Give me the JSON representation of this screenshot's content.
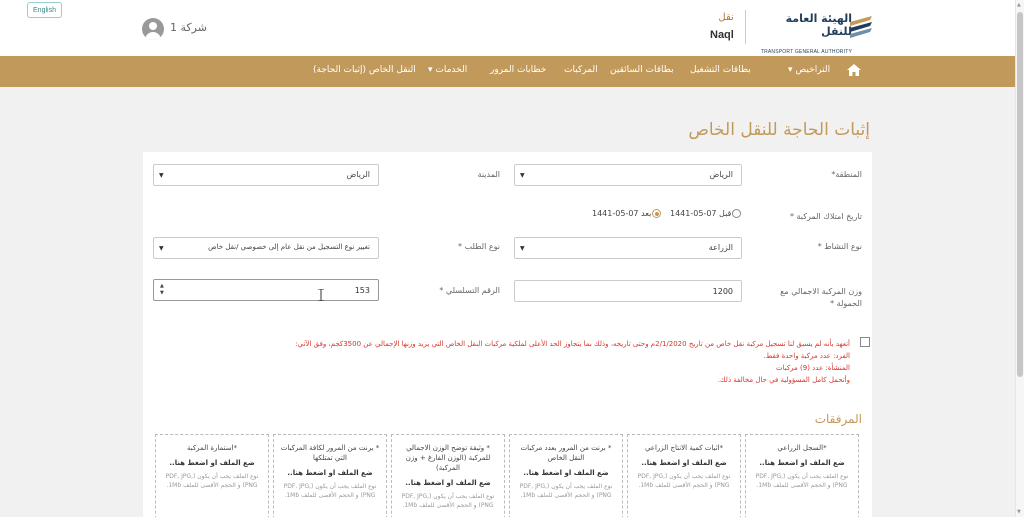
{
  "header": {
    "lang_button": "English",
    "company_label": "شركة 1",
    "naql_ar": "نقل",
    "naql_en": "Naql",
    "authority_ar": "الهيئة العامة للنقل",
    "authority_en": "TRANSPORT GENERAL AUTHORITY"
  },
  "nav": {
    "items": [
      "التراخيص",
      "بطاقات التشغيل",
      "بطاقات السائقين",
      "المركبات",
      "خطابات المرور",
      "الخدمات",
      "النقل الخاص (إثبات الحاجة)"
    ]
  },
  "page_title": "إثبات الحاجة للنقل الخاص",
  "form": {
    "region_label": "المنطقة*",
    "region_value": "الرياض",
    "city_label": "المدينة",
    "city_value": "الرياض",
    "vehicle_date_label": "تاريخ امتلاك المركبة *",
    "date_before": "قبل 07-05-1441",
    "date_after": "بعد 07-05-1441",
    "activity_label": "نوع النشاط *",
    "activity_value": "الزراعة",
    "request_label": "نوع الطلب *",
    "request_value": "تغيير نوع التسجيل من نقل عام إلى خصوصي /نقل خاص",
    "weight_label_1": "وزن المركبة الاجمالي مع",
    "weight_label_2": "الحمولة *",
    "weight_value": "1200",
    "serial_label": "الرقم التسلسلي *",
    "serial_value": "153"
  },
  "pledge": {
    "line1": "أتعهد بأنه لم يسبق لنا تسجيل مركبة نقل خاص من تاريخ 2/1/2020م وحتى تاريخه، وذلك بما يتجاوز الحد الأعلى لملكية مركبات النقل الخاص التي يزيد وزنها الإجمالي عن 3500كجم، وفق الآتي:",
    "line2": "الفرد: عدد مركبة واحدة فقط.",
    "line3": "المنشأة: عدد (9) مركبات",
    "line4": "وأتحمل كامل المسؤولية في حال مخالفة ذلك."
  },
  "attachments": {
    "title": "المرفقات",
    "drop_text": "ضع الملف او اضغط هنا..",
    "note": "نوع الملف يجب أن يكون (PDF, JPG, PNG) و الحجم الأقصى للملف 1Mb.",
    "items": [
      {
        "title": "*السجل الزراعي"
      },
      {
        "title": "*اثبات كمية الانتاج الزراعي"
      },
      {
        "title": "* برنت من المرور بعدد مركبات النقل الخاص"
      },
      {
        "title": "* وثيقة توضح الوزن الاجمالي للمركبة (الوزن الفارغ + وزن المركبة)"
      },
      {
        "title": "* برنت من المرور لكافة المركبات التي تمتلكها"
      },
      {
        "title": "*استمارة المركبة"
      }
    ]
  },
  "colors": {
    "accent": "#c19a5b",
    "warning": "#d9342b"
  }
}
